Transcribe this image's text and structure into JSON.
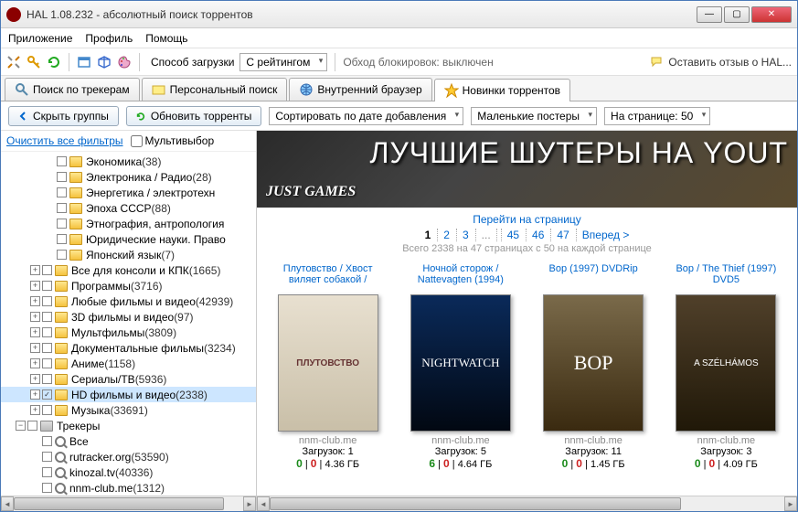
{
  "window": {
    "title": "HAL 1.08.232 - абсолютный поиск торрентов"
  },
  "menu": {
    "app": "Приложение",
    "profile": "Профиль",
    "help": "Помощь"
  },
  "toolbar": {
    "loadmode_label": "Способ загрузки",
    "loadmode_value": "С рейтингом",
    "bypass": "Обход блокировок: выключен",
    "feedback": "Оставить отзыв о HAL..."
  },
  "tabs": {
    "trackers": "Поиск по трекерам",
    "personal": "Персональный поиск",
    "browser": "Внутренний браузер",
    "news": "Новинки торрентов"
  },
  "btnbar": {
    "hide": "Скрыть группы",
    "refresh": "Обновить торренты",
    "sort": "Сортировать по дате добавления",
    "posters": "Маленькие постеры",
    "perpage_lbl": "На странице:",
    "perpage_val": "50"
  },
  "side": {
    "clear": "Очистить все фильтры",
    "multi": "Мультивыбор"
  },
  "tree": [
    {
      "d": 3,
      "t": "leaf",
      "label": "Экономика",
      "count": "(38)"
    },
    {
      "d": 3,
      "t": "leaf",
      "label": "Электроника / Радио",
      "count": "(28)"
    },
    {
      "d": 3,
      "t": "leaf",
      "label": "Энергетика / электротехн"
    },
    {
      "d": 3,
      "t": "leaf",
      "label": "Эпоха СССР",
      "count": "(88)"
    },
    {
      "d": 3,
      "t": "leaf",
      "label": "Этнография, антропология"
    },
    {
      "d": 3,
      "t": "leaf",
      "label": "Юридические науки. Право"
    },
    {
      "d": 3,
      "t": "leaf",
      "label": "Японский язык",
      "count": "(7)"
    },
    {
      "d": 2,
      "t": "branch",
      "exp": "+",
      "label": "Все для консоли и КПК",
      "count": "(1665)"
    },
    {
      "d": 2,
      "t": "branch",
      "exp": "+",
      "label": "Программы",
      "count": "(3716)"
    },
    {
      "d": 2,
      "t": "branch",
      "exp": "+",
      "label": "Любые фильмы и видео",
      "count": "(42939)"
    },
    {
      "d": 2,
      "t": "branch",
      "exp": "+",
      "label": "3D фильмы и видео",
      "count": "(97)"
    },
    {
      "d": 2,
      "t": "branch",
      "exp": "+",
      "label": "Мультфильмы",
      "count": "(3809)"
    },
    {
      "d": 2,
      "t": "branch",
      "exp": "+",
      "label": "Документальные фильмы",
      "count": "(3234)"
    },
    {
      "d": 2,
      "t": "branch",
      "exp": "+",
      "label": "Аниме",
      "count": "(1158)"
    },
    {
      "d": 2,
      "t": "branch",
      "exp": "+",
      "label": "Сериалы/ТВ",
      "count": "(5936)"
    },
    {
      "d": 2,
      "t": "branch",
      "exp": "+",
      "chk": "✓",
      "sel": true,
      "label": "HD фильмы и видео",
      "count": "(2338)"
    },
    {
      "d": 2,
      "t": "branch",
      "exp": "+",
      "label": "Музыка",
      "count": "(33691)"
    },
    {
      "d": 1,
      "t": "branch",
      "exp": "−",
      "gray": true,
      "label": "Трекеры"
    },
    {
      "d": 2,
      "t": "tracker",
      "label": "Все"
    },
    {
      "d": 2,
      "t": "tracker",
      "label": "rutracker.org",
      "count": "(53590)"
    },
    {
      "d": 2,
      "t": "tracker",
      "label": "kinozal.tv",
      "count": "(40336)"
    },
    {
      "d": 2,
      "t": "tracker",
      "label": "nnm-club.me",
      "count": "(1312)"
    }
  ],
  "banner": {
    "sub": "JUST GAMES",
    "title": "ЛУЧШИЕ ШУТЕРЫ НА YOUT"
  },
  "pager": {
    "title": "Перейти на страницу",
    "p1": "1",
    "p2": "2",
    "p3": "3",
    "dots": "...",
    "p45": "45",
    "p46": "46",
    "p47": "47",
    "fwd": "Вперед >",
    "summary": "Всего 2338 на 47 страницах с 50 на каждой странице"
  },
  "cards": [
    {
      "title": "Плутовство / Хвост виляет собакой /",
      "poster": "ПЛУТОВСТВО",
      "src": "nnm-club.me",
      "dl_lbl": "Загрузок:",
      "dl": "1",
      "seed": "0",
      "leech": "0",
      "size": "4.36 ГБ"
    },
    {
      "title": "Ночной сторож / Nattevagten (1994)",
      "poster": "NIGHTWATCH",
      "src": "nnm-club.me",
      "dl_lbl": "Загрузок:",
      "dl": "5",
      "seed": "6",
      "leech": "0",
      "size": "4.64 ГБ"
    },
    {
      "title": "Вор (1997) DVDRip",
      "poster": "ВОР",
      "src": "nnm-club.me",
      "dl_lbl": "Загрузок:",
      "dl": "11",
      "seed": "0",
      "leech": "0",
      "size": "1.45 ГБ"
    },
    {
      "title": "Вор / The Thief (1997) DVD5",
      "poster": "A SZÉLHÁMOS",
      "src": "nnm-club.me",
      "dl_lbl": "Загрузок:",
      "dl": "3",
      "seed": "0",
      "leech": "0",
      "size": "4.09 ГБ"
    }
  ]
}
